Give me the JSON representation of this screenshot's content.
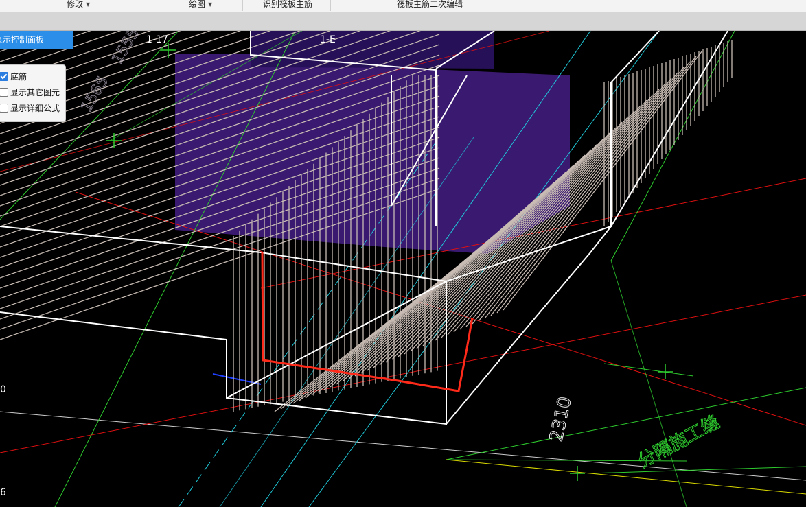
{
  "toolbar": {
    "modify": "修改",
    "draw": "绘图",
    "identify": "识别筏板主筋",
    "edit": "筏板主筋二次编辑"
  },
  "panel": {
    "header": "显示控制面板",
    "options": [
      {
        "label": "底筋",
        "checked": true
      },
      {
        "label": "显示其它图元",
        "checked": false
      },
      {
        "label": "显示详细公式",
        "checked": false
      }
    ]
  },
  "canvas_labels": {
    "axis_1_17": "1-17",
    "axis_1_e": "1-E",
    "dim_2310": "2310",
    "road_text": "分隔施工缝",
    "left_mark_0": "0",
    "left_mark_6": "6",
    "faint_a": "1555",
    "faint_b": "1565"
  },
  "colors": {
    "panel_header": "#2b8ee8",
    "rebar": "#c8bcb4",
    "highlight": "#ff2a1a",
    "column": "#5a2aa0",
    "grid_green": "#2ecc2e",
    "grid_cyan": "#1fc8d8",
    "grid_red": "#e01010"
  }
}
